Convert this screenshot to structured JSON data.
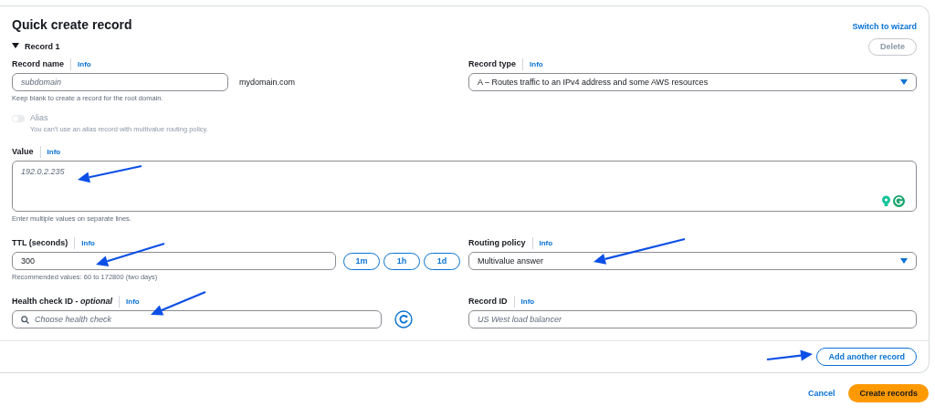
{
  "title": "Quick create record",
  "switch_link": "Switch to wizard",
  "record": {
    "heading": "Record 1",
    "expanded": true,
    "delete_button": {
      "label": "Delete",
      "disabled": true
    },
    "record_name": {
      "label": "Record name",
      "info": "Info",
      "placeholder": "subdomain",
      "suffix": "mydomain.com",
      "hint": "Keep blank to create a record for the root domain."
    },
    "record_type": {
      "label": "Record type",
      "info": "Info",
      "value": "A – Routes traffic to an IPv4 address and some AWS resources"
    },
    "alias": {
      "label": "Alias",
      "on": false,
      "disabled": true,
      "hint": "You can't use an alias record with multivalue routing policy."
    },
    "value": {
      "label": "Value",
      "info": "Info",
      "placeholder": "192.0.2.235",
      "hint": "Enter multiple values on separate lines."
    },
    "ttl": {
      "label": "TTL (seconds)",
      "info": "Info",
      "value": "300",
      "presets": [
        "1m",
        "1h",
        "1d"
      ],
      "hint": "Recommended values: 60 to 172800 (two days)"
    },
    "routing_policy": {
      "label": "Routing policy",
      "info": "Info",
      "value": "Multivalue answer"
    },
    "health_check": {
      "label": "Health check ID - *optional*",
      "info": "Info",
      "placeholder": "Choose health check"
    },
    "record_id": {
      "label": "Record ID",
      "info": "Info",
      "placeholder": "US West load balancer"
    }
  },
  "add_button": "Add another record",
  "footer": {
    "cancel": "Cancel",
    "create": "Create records"
  }
}
